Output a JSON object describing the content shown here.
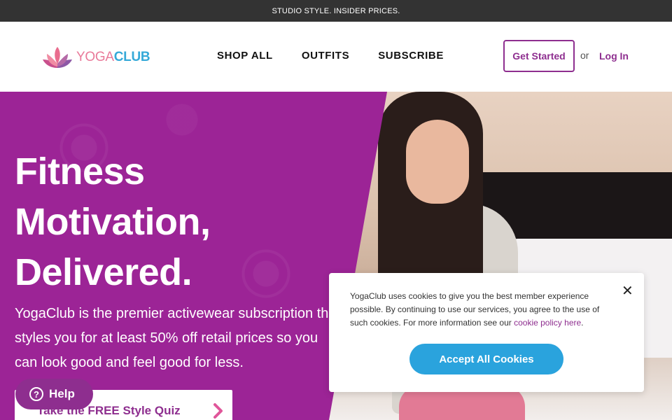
{
  "announcement": "STUDIO STYLE. INSIDER PRICES.",
  "logo": {
    "yoga": "YOGA",
    "club": "CLUB"
  },
  "nav": [
    {
      "label": "SHOP ALL"
    },
    {
      "label": "OUTFITS"
    },
    {
      "label": "SUBSCRIBE"
    }
  ],
  "header": {
    "get_started": "Get Started",
    "or": "or",
    "log_in": "Log In"
  },
  "hero": {
    "title_line1": "Fitness",
    "title_line2": "Motivation,",
    "title_line3": "Delivered.",
    "description": "YogaClub is the premier activewear subscription that styles you for at least 50% off retail prices so you can look good and feel good for less.",
    "cta": "Take the FREE Style Quiz"
  },
  "help": {
    "label": "Help"
  },
  "cookie_banner": {
    "text": "YogaClub uses cookies to give you the best member experience possible. By continuing to use our services, you agree to the use of such cookies. For more information see our ",
    "link_text": "cookie policy here",
    "after_link": ".",
    "accept_label": "Accept All Cookies",
    "close_symbol": "✕"
  },
  "colors": {
    "brand_purple": "#8e2e8f",
    "hero_purple": "#9c2496",
    "accent_blue": "#2aa3dd",
    "topbar": "#333333"
  }
}
